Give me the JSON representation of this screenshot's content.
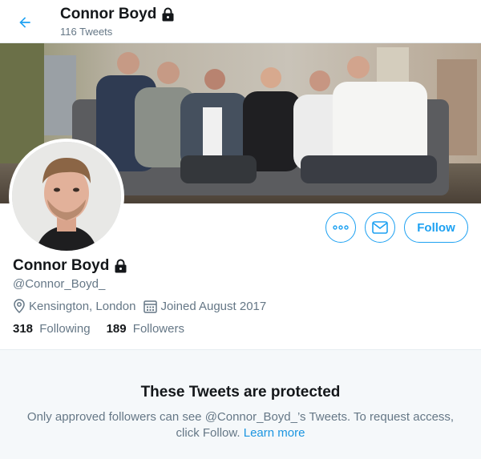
{
  "header": {
    "back_icon": "arrow-left-icon",
    "title": "Connor Boyd",
    "tweet_count": "116 Tweets",
    "lock_icon": "lock-icon"
  },
  "profile": {
    "name": "Connor Boyd",
    "handle": "@Connor_Boyd_",
    "location": "Kensington, London",
    "joined": "Joined August 2017",
    "following_count": "318",
    "following_label": "Following",
    "followers_count": "189",
    "followers_label": "Followers"
  },
  "actions": {
    "more_icon": "more-icon",
    "message_icon": "mail-icon",
    "follow_label": "Follow"
  },
  "protected": {
    "title": "These Tweets are protected",
    "message": "Only approved followers can see @Connor_Boyd_’s Tweets. To request access, click Follow.",
    "learn_more": "Learn more"
  },
  "colors": {
    "accent": "#1da1f2",
    "muted": "#657786",
    "text": "#14171a",
    "panel_bg": "#f5f8fa"
  }
}
